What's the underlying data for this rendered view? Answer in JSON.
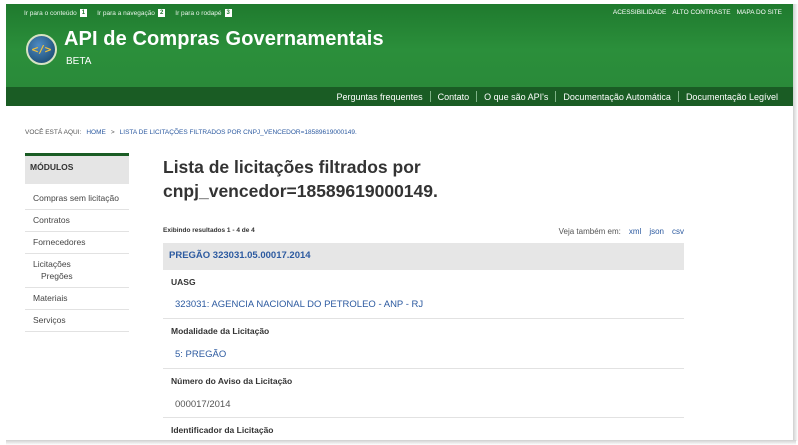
{
  "skip_links": [
    {
      "label": "Ir para o conteúdo",
      "num": "1"
    },
    {
      "label": "Ir para a navegação",
      "num": "2"
    },
    {
      "label": "Ir para o rodapé",
      "num": "3"
    }
  ],
  "accessibility_links": [
    "ACESSIBILIDADE",
    "ALTO CONTRASTE",
    "MAPA DO SITE"
  ],
  "header": {
    "logo_glyph": "</>",
    "title": "API de Compras Governamentais",
    "subtitle": "BETA"
  },
  "nav": [
    "Perguntas frequentes",
    "Contato",
    "O que são API's",
    "Documentação Automática",
    "Documentação Legível"
  ],
  "breadcrumb": {
    "prefix": "VOCÊ ESTÁ AQUI:",
    "home": "HOME",
    "separator": ">",
    "current": "LISTA DE LICITAÇÕES FILTRADOS POR CNPJ_VENCEDOR=18589619000149."
  },
  "sidebar": {
    "heading": "MÓDULOS",
    "items": [
      "Compras sem licitação",
      "Contratos",
      "Fornecedores",
      "Licitações",
      "Pregões",
      "Materiais",
      "Serviços"
    ]
  },
  "main": {
    "title_line1": "Lista de licitações filtrados por",
    "title_line2": "cnpj_vencedor=18589619000149.",
    "results_text": "Exibindo resultados 1 - 4 de 4",
    "see_also_label": "Veja também em:",
    "formats": [
      "xml",
      "json",
      "csv"
    ],
    "record": {
      "heading": "PREGÃO 323031.05.00017.2014",
      "fields": [
        {
          "label": "UASG",
          "value": "323031: AGENCIA NACIONAL DO PETROLEO - ANP - RJ"
        },
        {
          "label": "Modalidade da Licitação",
          "value": "5: PREGÃO"
        },
        {
          "label": "Número do Aviso da Licitação",
          "value": "000017/2014"
        },
        {
          "label": "Identificador da Licitação",
          "value": ""
        }
      ]
    }
  },
  "colors": {
    "header_green": "#2b8f3b",
    "nav_green": "#1a5c24",
    "link_blue": "#2c5aa0"
  }
}
